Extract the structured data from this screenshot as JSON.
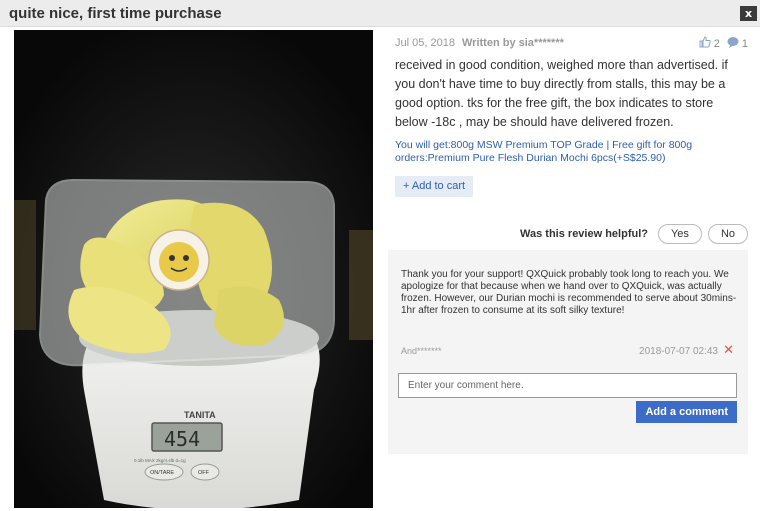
{
  "window": {
    "title": "quite nice, first time purchase",
    "close_label": "x"
  },
  "review": {
    "date": "Jul 05, 2018",
    "author": "Written by sia*******",
    "like_count": "2",
    "comment_count": "1",
    "text": "received in good condition, weighed more than advertised. if you don't have time to buy directly from stalls, this may be a good option. tks for the free gift, the box indicates to store below -18c , may be should have delivered frozen.",
    "variant": "You will get:800g MSW Premium TOP Grade | Free gift for 800g orders:Premium Pure Flesh Durian Mochi 6pcs(+S$25.90)",
    "add_to_cart": "+ Add to cart"
  },
  "photo": {
    "scale_brand": "TANITA",
    "scale_reading": "454",
    "btn_on_tare": "ON/TARE",
    "btn_off": "OFF",
    "scale_fine_print": "0.1lb  MAX 2kg/4.4lb  d=1g"
  },
  "helpful": {
    "label": "Was this review helpful?",
    "yes": "Yes",
    "no": "No"
  },
  "reply": {
    "text": "Thank you for your support! QXQuick probably took long to reach you. We apologize for that because when we hand over to QXQuick, was actually frozen. However, our Durian mochi is recommended to serve about 30mins-1hr after frozen to consume at its soft silky texture!",
    "author": "And*******",
    "date": "2018-07-07 02:43",
    "delete_icon": "close-icon",
    "comment_placeholder": "Enter your comment here.",
    "add_comment": "Add a comment"
  },
  "colors": {
    "accent": "#3d6cc8",
    "link": "#2d5fb0",
    "delete": "#d9534f"
  }
}
